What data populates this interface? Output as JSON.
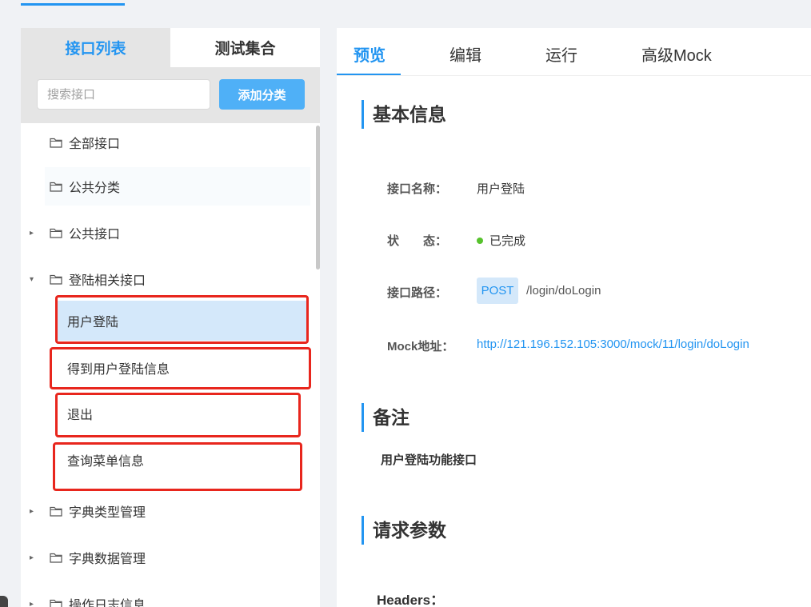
{
  "sidebar": {
    "tabs": [
      {
        "label": "接口列表",
        "active": true
      },
      {
        "label": "测试集合",
        "active": false
      }
    ],
    "search": {
      "placeholder": "搜索接口"
    },
    "add_button": "添加分类",
    "tree": [
      {
        "label": "全部接口",
        "caret": ""
      },
      {
        "label": "公共分类",
        "caret": ""
      },
      {
        "label": "公共接口",
        "caret": "▸"
      },
      {
        "label": "登陆相关接口",
        "caret": "▾"
      },
      {
        "label": "字典类型管理",
        "caret": "▸"
      },
      {
        "label": "字典数据管理",
        "caret": "▸"
      },
      {
        "label": "操作日志信息",
        "caret": "▸"
      }
    ],
    "leaves": [
      {
        "label": "用户登陆",
        "selected": true
      },
      {
        "label": "得到用户登陆信息",
        "selected": false
      },
      {
        "label": "退出",
        "selected": false
      },
      {
        "label": "查询菜单信息",
        "selected": false
      }
    ]
  },
  "main": {
    "tabs": [
      {
        "label": "预览",
        "active": true
      },
      {
        "label": "编辑",
        "active": false
      },
      {
        "label": "运行",
        "active": false
      },
      {
        "label": "高级Mock",
        "active": false
      }
    ],
    "basic_info": {
      "title": "基本信息",
      "name_label": "接口名称：",
      "name_value": "用户登陆",
      "status_label": "状　　态：",
      "status_value": "已完成",
      "path_label": "接口路径：",
      "method": "POST",
      "path": "/login/doLogin",
      "mock_label": "Mock地址：",
      "mock_url": "http://121.196.152.105:3000/mock/11/login/doLogin"
    },
    "remark": {
      "title": "备注",
      "text": "用户登陆功能接口"
    },
    "request": {
      "title": "请求参数",
      "headers_label": "Headers："
    }
  },
  "colors": {
    "accent": "#2395f1",
    "annotation_red": "#e8261d",
    "status_green": "#57c22d"
  }
}
